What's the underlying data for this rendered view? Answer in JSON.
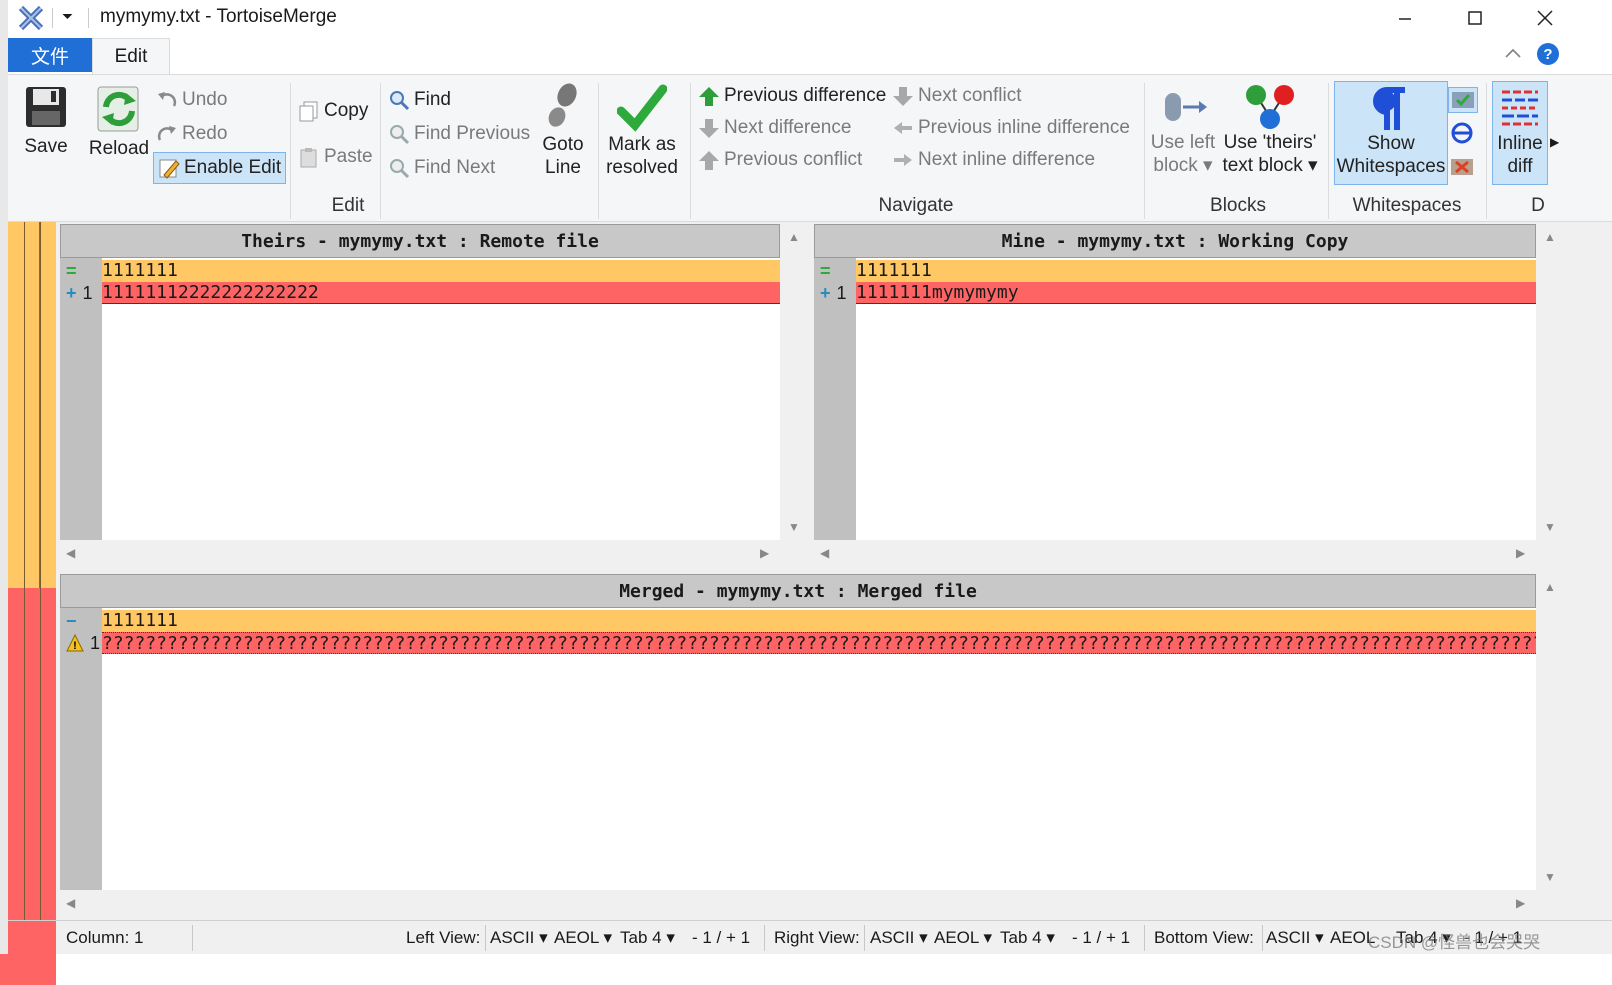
{
  "window": {
    "title": "mymymy.txt - TortoiseMerge"
  },
  "menu": {
    "file": "文件",
    "edit": "Edit"
  },
  "ribbon": {
    "save": "Save",
    "reload": "Reload",
    "undo": "Undo",
    "redo": "Redo",
    "enable_edit": "Enable Edit",
    "copy": "Copy",
    "paste": "Paste",
    "find": "Find",
    "find_previous": "Find Previous",
    "find_next": "Find Next",
    "goto_line_1": "Goto",
    "goto_line_2": "Line",
    "mark_resolved_1": "Mark as",
    "mark_resolved_2": "resolved",
    "group_edit": "Edit",
    "prev_difference": "Previous difference",
    "next_difference": "Next difference",
    "prev_conflict": "Previous conflict",
    "next_conflict": "Next conflict",
    "prev_inline": "Previous inline difference",
    "next_inline": "Next inline difference",
    "group_navigate": "Navigate",
    "use_left_1": "Use left",
    "use_left_2": "block",
    "use_theirs_1": "Use 'theirs'",
    "use_theirs_2": "text block",
    "group_blocks": "Blocks",
    "show_ws_1": "Show",
    "show_ws_2": "Whitespaces",
    "group_whitespaces": "Whitespaces",
    "inline_1": "Inline",
    "inline_2": "diff",
    "group_d": "D"
  },
  "panes": {
    "theirs": {
      "header": "Theirs - mymymy.txt : Remote file",
      "lines": [
        {
          "marker": "=",
          "num": "",
          "text": "1111111"
        },
        {
          "marker": "+",
          "num": "1",
          "text": "11111112222222222222"
        }
      ]
    },
    "mine": {
      "header": "Mine - mymymy.txt : Working Copy",
      "lines": [
        {
          "marker": "=",
          "num": "",
          "text": "1111111"
        },
        {
          "marker": "+",
          "num": "1",
          "text": "1111111mymymymy"
        }
      ]
    },
    "merged": {
      "header": "Merged - mymymy.txt : Merged file",
      "lines": [
        {
          "marker": "−",
          "num": "",
          "text": "1111111"
        },
        {
          "marker": "!",
          "num": "1",
          "text": "??????????????????????????????????????????????????????????????????????????????????????????????????????????????????????????????????????"
        }
      ]
    }
  },
  "status": {
    "column": "Column: 1",
    "left_view": "Left View:",
    "left_enc": "ASCII",
    "left_eol": "AEOL",
    "left_tab": "Tab 4",
    "left_diff": "- 1 / + 1",
    "right_view": "Right View:",
    "right_enc": "ASCII",
    "right_eol": "AEOL",
    "right_tab": "Tab 4",
    "right_diff": "- 1 / + 1",
    "bottom_view": "Bottom View:",
    "bottom_enc": "ASCII",
    "bottom_eol": "AEOL",
    "bottom_tab": "Tab 4",
    "bottom_diff": "- 1 / + 1",
    "watermark": "CSDN @怪兽也会哭哭"
  },
  "colors": {
    "equal_row": "#ffc864",
    "conflict_row": "#ff6464",
    "accent": "#1f6fd6"
  }
}
